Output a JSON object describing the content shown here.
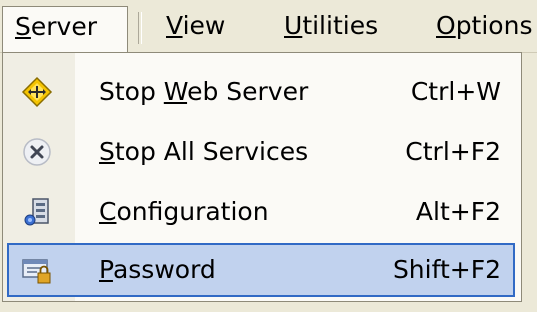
{
  "menubar": {
    "items": [
      {
        "prefix": "",
        "mnemonic": "S",
        "rest": "erver"
      },
      {
        "prefix": "",
        "mnemonic": "V",
        "rest": "iew"
      },
      {
        "prefix": "",
        "mnemonic": "U",
        "rest": "tilities"
      },
      {
        "prefix": "",
        "mnemonic": "O",
        "rest": "ptions"
      }
    ]
  },
  "server_menu": {
    "items": [
      {
        "icon": "web-server-diamond-icon",
        "prefix": "Stop ",
        "mnemonic": "W",
        "rest": "eb Server",
        "shortcut": "Ctrl+W"
      },
      {
        "icon": "stop-circle-x-icon",
        "prefix": "",
        "mnemonic": "S",
        "rest": "top All Services",
        "shortcut": "Ctrl+F2"
      },
      {
        "icon": "configuration-icon",
        "prefix": "",
        "mnemonic": "C",
        "rest": "onfiguration",
        "shortcut": "Alt+F2"
      },
      {
        "icon": "password-lock-icon",
        "prefix": "",
        "mnemonic": "P",
        "rest": "assword",
        "shortcut": "Shift+F2"
      }
    ],
    "highlighted_index": 3
  },
  "colors": {
    "menubar_bg": "#ece9d8",
    "menu_bg": "#fbfaf6",
    "highlight_bg": "#c1d2ee",
    "highlight_border": "#316ac5"
  }
}
